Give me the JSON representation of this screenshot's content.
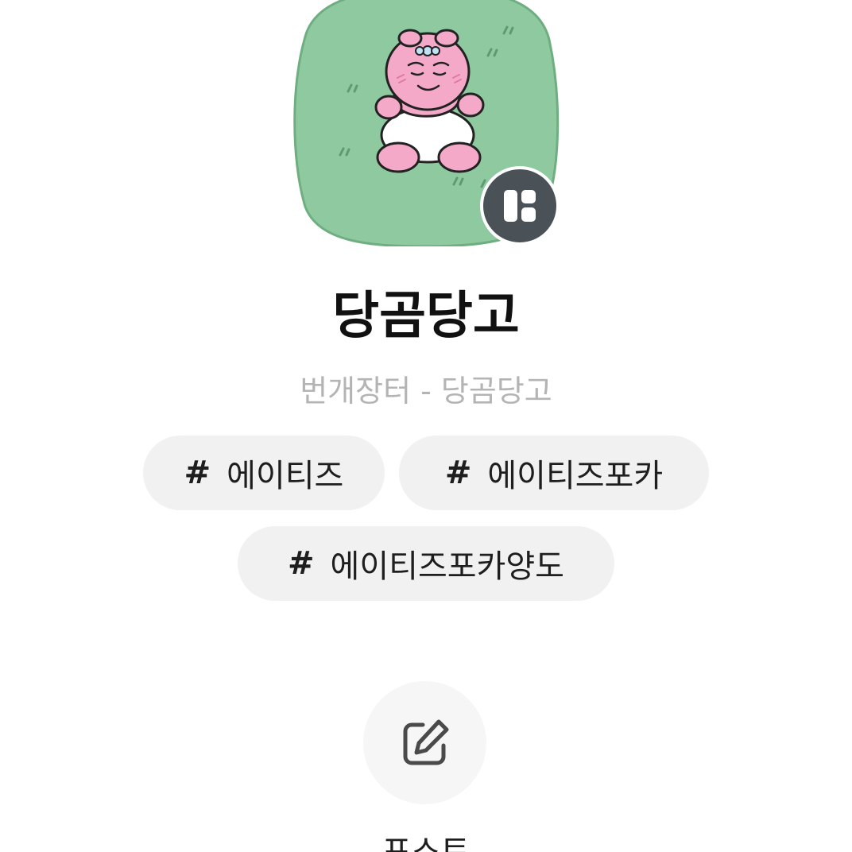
{
  "profile": {
    "name": "당곰당고",
    "description": "번개장터 - 당곰당고"
  },
  "tags": [
    {
      "hash": "#",
      "label": "에이티즈"
    },
    {
      "hash": "#",
      "label": "에이티즈포카"
    },
    {
      "hash": "#",
      "label": "에이티즈포카양도"
    }
  ],
  "actions": {
    "post_label": "포스트"
  },
  "icons": {
    "badge": "bunjang-logo-icon",
    "post": "edit-icon"
  },
  "colors": {
    "avatar_bg": "#8fc9a0",
    "badge_bg": "#4a5257",
    "tag_bg": "#f1f1f1",
    "description": "#b4b4b4"
  }
}
